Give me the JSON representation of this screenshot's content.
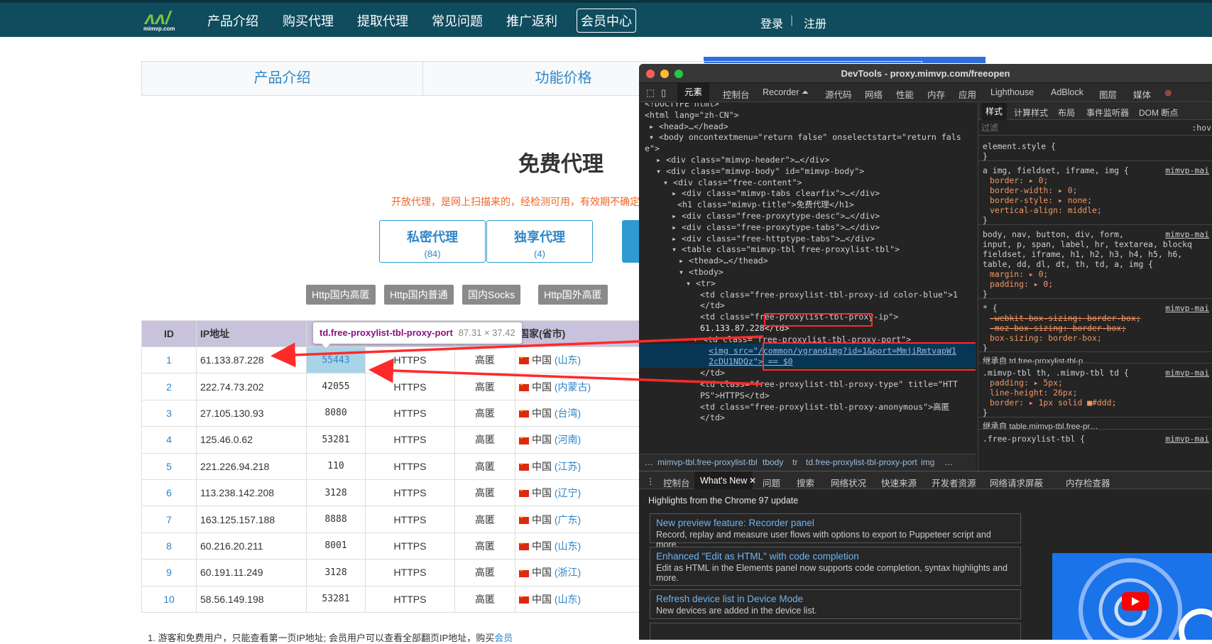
{
  "site": {
    "logo_text": "mimvp.com",
    "nav": [
      "产品介绍",
      "购买代理",
      "提取代理",
      "常见问题",
      "推广返利",
      "会员中心"
    ],
    "login": "登录",
    "register": "注册"
  },
  "page_tabs": [
    "产品介绍",
    "功能价格"
  ],
  "page_title": "免费代理",
  "description": "开放代理，是网上扫描来的，经检测可用，有效期不确定",
  "proxy_types": [
    {
      "label": "私密代理",
      "count": "(84)"
    },
    {
      "label": "独享代理",
      "count": "(4)"
    }
  ],
  "http_types": [
    "Http国内高匿",
    "Http国内普通",
    "国内Socks",
    "Http国外高匿"
  ],
  "table": {
    "headers": {
      "id": "ID",
      "ip": "IP地址",
      "region": "国家(省市)"
    },
    "rows": [
      {
        "id": "1",
        "ip": "61.133.87.228",
        "port": "55443",
        "type": "HTTPS",
        "anon": "高匿",
        "country": "中国",
        "province": "(山东)"
      },
      {
        "id": "2",
        "ip": "222.74.73.202",
        "port": "42055",
        "type": "HTTPS",
        "anon": "高匿",
        "country": "中国",
        "province": "(内蒙古)"
      },
      {
        "id": "3",
        "ip": "27.105.130.93",
        "port": "8080",
        "type": "HTTPS",
        "anon": "高匿",
        "country": "中国",
        "province": "(台湾)"
      },
      {
        "id": "4",
        "ip": "125.46.0.62",
        "port": "53281",
        "type": "HTTPS",
        "anon": "高匿",
        "country": "中国",
        "province": "(河南)"
      },
      {
        "id": "5",
        "ip": "221.226.94.218",
        "port": "110",
        "type": "HTTPS",
        "anon": "高匿",
        "country": "中国",
        "province": "(江苏)"
      },
      {
        "id": "6",
        "ip": "113.238.142.208",
        "port": "3128",
        "type": "HTTPS",
        "anon": "高匿",
        "country": "中国",
        "province": "(辽宁)"
      },
      {
        "id": "7",
        "ip": "163.125.157.188",
        "port": "8888",
        "type": "HTTPS",
        "anon": "高匿",
        "country": "中国",
        "province": "(广东)"
      },
      {
        "id": "8",
        "ip": "60.216.20.211",
        "port": "8001",
        "type": "HTTPS",
        "anon": "高匿",
        "country": "中国",
        "province": "(山东)"
      },
      {
        "id": "9",
        "ip": "60.191.11.249",
        "port": "3128",
        "type": "HTTPS",
        "anon": "高匿",
        "country": "中国",
        "province": "(浙江)"
      },
      {
        "id": "10",
        "ip": "58.56.149.198",
        "port": "53281",
        "type": "HTTPS",
        "anon": "高匿",
        "country": "中国",
        "province": "(山东)"
      }
    ]
  },
  "tooltip": {
    "selector": "td.free-proxylist-tbl-proxy-port",
    "size": "87.31 × 37.42"
  },
  "footnote": {
    "text": "1. 游客和免费用户，只能查看第一页IP地址; 会员用户可以查看全部翻页IP地址，购买",
    "link": "会员"
  },
  "devtools": {
    "title": "DevTools - proxy.mimvp.com/freeopen",
    "tabs": [
      "元素",
      "控制台",
      "Recorder ⏶",
      "源代码",
      "网络",
      "性能",
      "内存",
      "应用",
      "Lighthouse",
      "AdBlock",
      "图层",
      "媒体"
    ],
    "elements": [
      "<!DOCTYPE html>",
      "<html lang=\"zh-CN\">",
      "▸ <head>…</head>",
      "▾ <body oncontextmenu=\"return false\" onselectstart=\"return fals",
      "e\">",
      "▸ <div class=\"mimvp-header\">…</div>",
      "▾ <div class=\"mimvp-body\" id=\"mimvp-body\">",
      "▾ <div class=\"free-content\">",
      "▸ <div class=\"mimvp-tabs clearfix\">…</div>",
      "<h1 class=\"mimvp-title\">免费代理</h1>",
      "▸ <div class=\"free-proxytype-desc\">…</div>",
      "▸ <div class=\"free-proxytype-tabs\">…</div>",
      "▸ <div class=\"free-httptype-tabs\">…</div>",
      "▾ <table class=\"mimvp-tbl free-proxylist-tbl\">",
      "▸ <thead>…</thead>",
      "▾ <tbody>",
      "▾ <tr>",
      "<td class=\"free-proxylist-tbl-proxy-id color-blue\">1",
      "</td>",
      "<td class=\"free-proxylist-tbl-proxy-ip\">",
      "61.133.87.228</td>",
      "▾ <td class=\"free-proxylist-tbl-proxy-port\">",
      "<img src=\"/common/ygrandimg?id=1&port=MmjiRmtvapW1",
      "2cDU1NDQz\"> == $0",
      "</td>",
      "<td class=\"free-proxylist-tbl-proxy-type\" title=\"HTT",
      "PS\">HTTPS</td>",
      "<td class=\"free-proxylist-tbl-proxy-anonymous\">高匿",
      "</td>"
    ],
    "breadcrumb": [
      "…",
      "mimvp-tbl.free-proxylist-tbl",
      "tbody",
      "tr",
      "td.free-proxylist-tbl-proxy-port",
      "img",
      "…"
    ],
    "styles_tabs": [
      "样式",
      "计算样式",
      "布局",
      "事件监听器",
      "DOM 断点"
    ],
    "filter_placeholder": "过滤",
    "hov": ":hov",
    "styles": [
      "element.style {",
      "}",
      "a img, fieldset, iframe, img {",
      "border: ▸ 0;",
      "border-width: ▸ 0;",
      "border-style: ▸ none;",
      "vertical-align: middle;",
      "}",
      "body, nav, button, div, form,",
      "input, p, span, label, hr, textarea, blockq",
      "fieldset, iframe, h1, h2, h3, h4, h5, h6,",
      "table, dd, dl, dt, th, td, a, img {",
      "margin: ▸ 0;",
      "padding: ▸ 0;",
      "}",
      "* {",
      "-webkit-box-sizing: border-box;",
      "-moz-box-sizing: border-box;",
      "box-sizing: border-box;",
      "}",
      "继承自 td.free-proxylist-tbl-p…",
      ".mimvp-tbl th, .mimvp-tbl td {",
      "padding: ▸ 5px;",
      "line-height: 26px;",
      "border: ▸ 1px solid ■#ddd;",
      "}",
      "继承自 table.mimvp-tbl.free-pr…",
      ".free-proxylist-tbl {"
    ],
    "style_src": "mimvp-mai",
    "drawer_tabs": [
      "控制台",
      "What's New",
      "问题",
      "搜索",
      "网络状况",
      "快速来源",
      "开发者资源",
      "网络请求屏蔽",
      "内存检查器"
    ],
    "whats_new_header": "Highlights from the Chrome 97 update",
    "cards": [
      {
        "title": "New preview feature: Recorder panel",
        "body": "Record, replay and measure user flows with options to export to Puppeteer script and more."
      },
      {
        "title": "Enhanced \"Edit as HTML\" with code completion",
        "body": "Edit as HTML in the Elements panel now supports code completion, syntax highlights and more."
      },
      {
        "title": "Refresh device list in Device Mode",
        "body": "New devices are added in the device list."
      }
    ]
  },
  "colors": {
    "header": "#0f4c5e",
    "accent": "#2f86c8",
    "annotation": "#ff2a2a"
  }
}
